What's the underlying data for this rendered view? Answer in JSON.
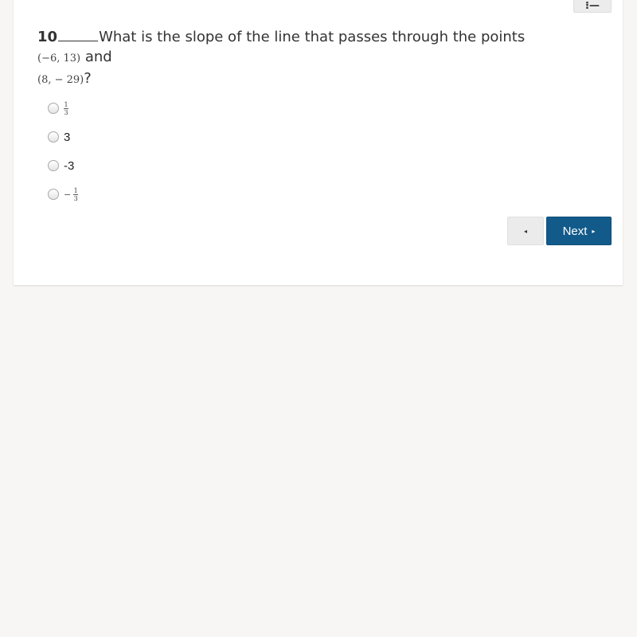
{
  "toolbar": {
    "tool_icon": "list-icon",
    "tool_glyph": "⁝—"
  },
  "question": {
    "number": "10",
    "text": "What is the slope of the line that passes through the points",
    "point1": "(−6, 13)",
    "connector": "and",
    "point2": "(8, − 29)",
    "end": "?"
  },
  "options": [
    {
      "type": "fraction",
      "sign": "",
      "numerator": "1",
      "denominator": "3",
      "selected": false
    },
    {
      "type": "text",
      "label": "3",
      "selected": false
    },
    {
      "type": "text",
      "label": "-3",
      "selected": false
    },
    {
      "type": "fraction",
      "sign": "−",
      "numerator": "1",
      "denominator": "3",
      "selected": false
    }
  ],
  "nav": {
    "prev_glyph": "◂",
    "next_label": "Next",
    "next_glyph": "▸",
    "next_color": "#125a8a"
  }
}
